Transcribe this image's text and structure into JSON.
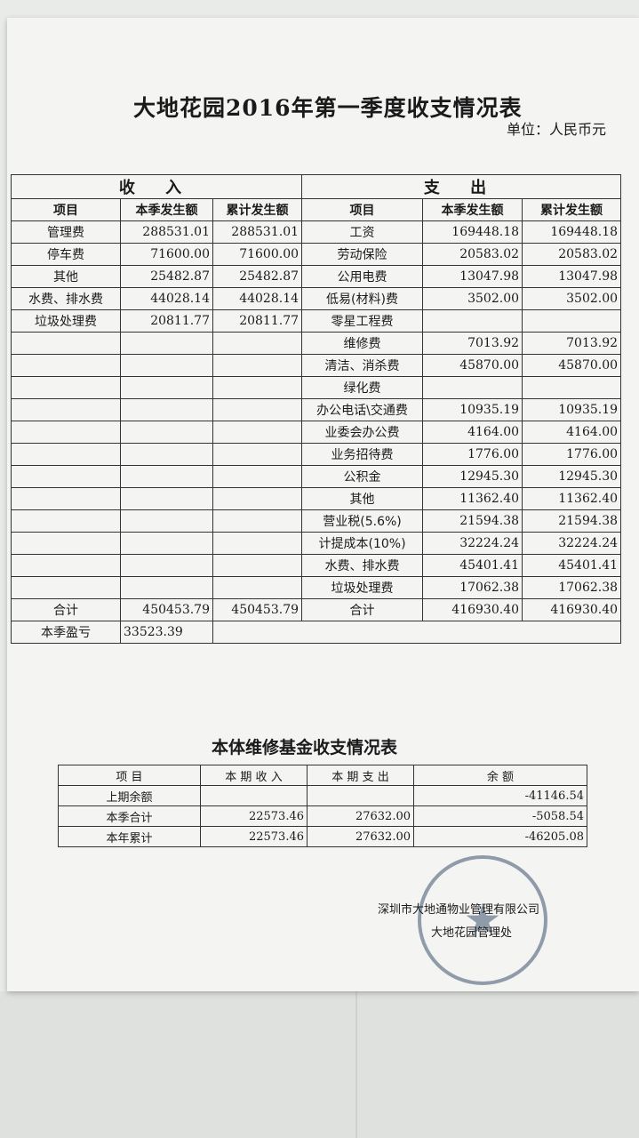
{
  "title": "大地花园2016年第一季度收支情况表",
  "unit": "单位：人民币元",
  "income_header": "收 入",
  "expense_header": "支 出",
  "col_headers": {
    "item": "项目",
    "current": "本季发生额",
    "cumulative": "累计发生额"
  },
  "rows": [
    {
      "in_item": "管理费",
      "in_cur": "288531.01",
      "in_cum": "288531.01",
      "ex_item": "工资",
      "ex_cur": "169448.18",
      "ex_cum": "169448.18"
    },
    {
      "in_item": "停车费",
      "in_cur": "71600.00",
      "in_cum": "71600.00",
      "ex_item": "劳动保险",
      "ex_cur": "20583.02",
      "ex_cum": "20583.02"
    },
    {
      "in_item": "其他",
      "in_cur": "25482.87",
      "in_cum": "25482.87",
      "ex_item": "公用电费",
      "ex_cur": "13047.98",
      "ex_cum": "13047.98"
    },
    {
      "in_item": "水费、排水费",
      "in_cur": "44028.14",
      "in_cum": "44028.14",
      "ex_item": "低易(材料)费",
      "ex_cur": "3502.00",
      "ex_cum": "3502.00"
    },
    {
      "in_item": "垃圾处理费",
      "in_cur": "20811.77",
      "in_cum": "20811.77",
      "ex_item": "零星工程费",
      "ex_cur": "",
      "ex_cum": ""
    },
    {
      "in_item": "",
      "in_cur": "",
      "in_cum": "",
      "ex_item": "维修费",
      "ex_cur": "7013.92",
      "ex_cum": "7013.92"
    },
    {
      "in_item": "",
      "in_cur": "",
      "in_cum": "",
      "ex_item": "清洁、消杀费",
      "ex_cur": "45870.00",
      "ex_cum": "45870.00"
    },
    {
      "in_item": "",
      "in_cur": "",
      "in_cum": "",
      "ex_item": "绿化费",
      "ex_cur": "",
      "ex_cum": ""
    },
    {
      "in_item": "",
      "in_cur": "",
      "in_cum": "",
      "ex_item": "办公电话\\交通费",
      "ex_cur": "10935.19",
      "ex_cum": "10935.19"
    },
    {
      "in_item": "",
      "in_cur": "",
      "in_cum": "",
      "ex_item": "业委会办公费",
      "ex_cur": "4164.00",
      "ex_cum": "4164.00"
    },
    {
      "in_item": "",
      "in_cur": "",
      "in_cum": "",
      "ex_item": "业务招待费",
      "ex_cur": "1776.00",
      "ex_cum": "1776.00"
    },
    {
      "in_item": "",
      "in_cur": "",
      "in_cum": "",
      "ex_item": "公积金",
      "ex_cur": "12945.30",
      "ex_cum": "12945.30"
    },
    {
      "in_item": "",
      "in_cur": "",
      "in_cum": "",
      "ex_item": "其他",
      "ex_cur": "11362.40",
      "ex_cum": "11362.40"
    },
    {
      "in_item": "",
      "in_cur": "",
      "in_cum": "",
      "ex_item": "营业税(5.6%)",
      "ex_cur": "21594.38",
      "ex_cum": "21594.38"
    },
    {
      "in_item": "",
      "in_cur": "",
      "in_cum": "",
      "ex_item": "计提成本(10%)",
      "ex_cur": "32224.24",
      "ex_cum": "32224.24"
    },
    {
      "in_item": "",
      "in_cur": "",
      "in_cum": "",
      "ex_item": "水费、排水费",
      "ex_cur": "45401.41",
      "ex_cum": "45401.41"
    },
    {
      "in_item": "",
      "in_cur": "",
      "in_cum": "",
      "ex_item": "垃圾处理费",
      "ex_cur": "17062.38",
      "ex_cum": "17062.38"
    }
  ],
  "totals": {
    "in_label": "合计",
    "in_cur": "450453.79",
    "in_cum": "450453.79",
    "ex_label": "合计",
    "ex_cur": "416930.40",
    "ex_cum": "416930.40"
  },
  "profit": {
    "label": "本季盈亏",
    "value": "33523.39"
  },
  "fund_title": "本体维修基金收支情况表",
  "fund_headers": {
    "item": "项 目",
    "income": "本 期 收 入",
    "expense": "本 期 支 出",
    "balance": "余 额"
  },
  "fund_rows": [
    {
      "item": "上期余额",
      "income": "",
      "expense": "",
      "balance": "-41146.54"
    },
    {
      "item": "本季合计",
      "income": "22573.46",
      "expense": "27632.00",
      "balance": "-5058.54"
    },
    {
      "item": "本年累计",
      "income": "22573.46",
      "expense": "27632.00",
      "balance": "-46205.08"
    }
  ],
  "company": "深圳市大地通物业管理有限公司",
  "company_branch": "大地花园管理处"
}
